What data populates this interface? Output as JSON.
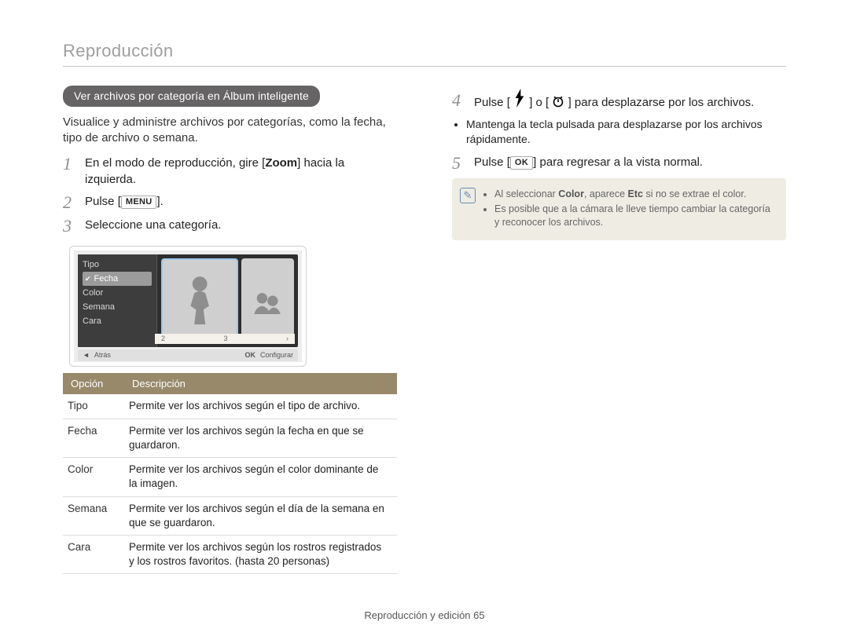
{
  "header": {
    "title": "Reproducción"
  },
  "leftCol": {
    "pill": "Ver archivos por categoría en Álbum inteligente",
    "intro": "Visualice y administre archivos por categorías, como la fecha, tipo de archivo o semana.",
    "steps": {
      "s1": {
        "num": "1",
        "pre": "En el modo de reproducción, gire [",
        "zoom": "Zoom",
        "post": "] hacia la izquierda."
      },
      "s2": {
        "num": "2",
        "pre": "Pulse [",
        "btn": "MENU",
        "post": "]."
      },
      "s3": {
        "num": "3",
        "text": "Seleccione una categoría."
      }
    },
    "lcd": {
      "menu": {
        "tipo": "Tipo",
        "fecha": "Fecha",
        "color": "Color",
        "semana": "Semana",
        "cara": "Cara"
      },
      "thumbBar": {
        "n2": "2",
        "n3": "3",
        "arrow": "›"
      },
      "bar": {
        "backArrow": "◄",
        "back": "Atrás",
        "ok": "OK",
        "config": "Configurar"
      }
    },
    "table": {
      "hOpt": "Opción",
      "hDesc": "Descripción",
      "rows": [
        {
          "opt": "Tipo",
          "desc": "Permite ver los archivos según el tipo de archivo."
        },
        {
          "opt": "Fecha",
          "desc": "Permite ver los archivos según la fecha en que se guardaron."
        },
        {
          "opt": "Color",
          "desc": "Permite ver los archivos según el color dominante de la imagen."
        },
        {
          "opt": "Semana",
          "desc": "Permite ver los archivos según el día de la semana en que se guardaron."
        },
        {
          "opt": "Cara",
          "desc": "Permite ver los archivos según los rostros registrados y los rostros favoritos. (hasta 20 personas)"
        }
      ]
    }
  },
  "rightCol": {
    "s4": {
      "num": "4",
      "pre": "Pulse [",
      "mid": "] o [",
      "post": "] para desplazarse por los archivos."
    },
    "s4Bullet": "Mantenga la tecla pulsada para desplazarse por los archivos rápidamente.",
    "s5": {
      "num": "5",
      "pre": "Pulse [",
      "btn": "OK",
      "post": "] para regresar a la vista normal."
    },
    "note": {
      "l1a": "Al seleccionar ",
      "l1b": "Color",
      "l1c": ", aparece ",
      "l1d": "Etc",
      "l1e": " si no se extrae el color.",
      "l2": "Es posible que a la cámara le lleve tiempo cambiar la categoría y reconocer los archivos."
    }
  },
  "footer": {
    "text": "Reproducción y edición  65"
  }
}
